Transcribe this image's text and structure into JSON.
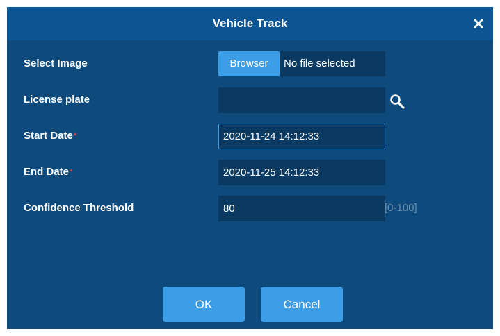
{
  "dialog": {
    "title": "Vehicle Track",
    "close_label": "×"
  },
  "fields": {
    "select_image": {
      "label": "Select Image",
      "browse_label": "Browser",
      "file_status": "No file selected"
    },
    "license_plate": {
      "label": "License plate",
      "value": ""
    },
    "start_date": {
      "label": "Start Date",
      "required_mark": "*",
      "value": "2020-11-24 14:12:33"
    },
    "end_date": {
      "label": "End Date",
      "required_mark": "*",
      "value": "2020-11-25 14:12:33"
    },
    "confidence_threshold": {
      "label": "Confidence Threshold",
      "value": "80",
      "range_hint": "[0-100]"
    }
  },
  "buttons": {
    "ok_label": "OK",
    "cancel_label": "Cancel"
  },
  "colors": {
    "dialog_bg": "#0e4b7c",
    "titlebar_bg": "#0b5595",
    "input_bg": "#0a3a61",
    "accent": "#3d9ee8",
    "required": "#e64343"
  },
  "icons": {
    "search": "search-icon",
    "close": "close-icon"
  }
}
